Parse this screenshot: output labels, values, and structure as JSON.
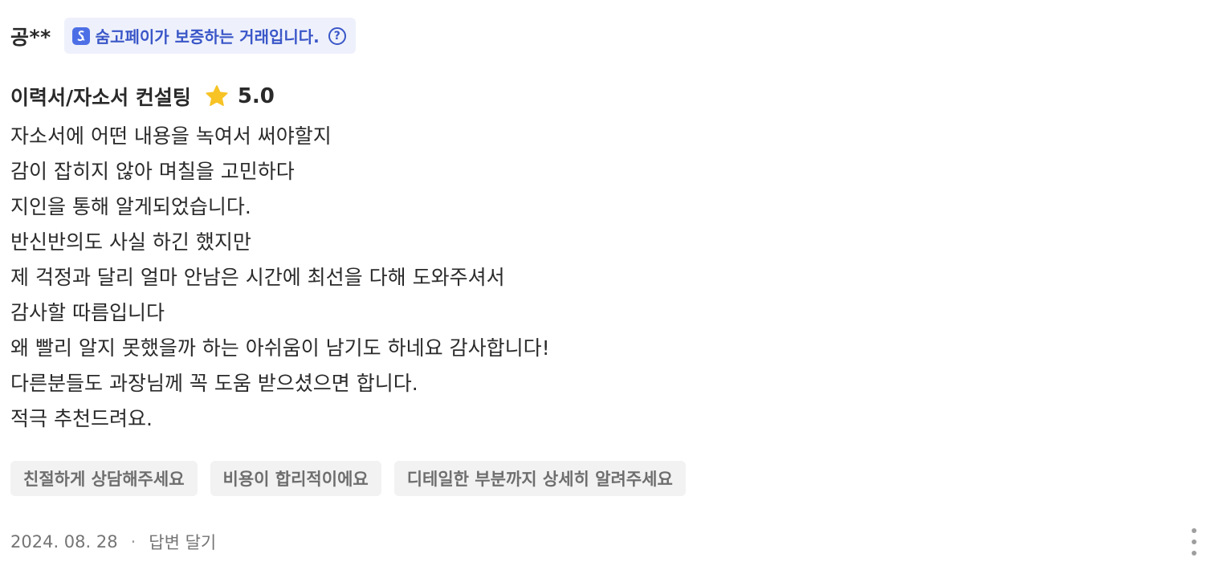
{
  "review": {
    "reviewer_name": "공**",
    "pay_badge": {
      "icon": "soomgo-pay-logo-icon",
      "text": "숨고페이가 보증하는 거래입니다.",
      "help_icon": "question-circle-icon",
      "help_glyph": "?"
    },
    "service_name": "이력서/자소서 컨설팅",
    "rating_icon": "star-icon",
    "rating": "5.0",
    "body_lines": [
      "자소서에 어떤 내용을 녹여서 써야할지",
      "감이 잡히지 않아 며칠을 고민하다",
      "지인을 통해 알게되었습니다.",
      "반신반의도 사실 하긴 했지만",
      "제 걱정과 달리 얼마 안남은 시간에 최선을 다해 도와주셔서",
      "감사할 따름입니다",
      "왜 빨리 알지 못했을까 하는 아쉬움이 남기도 하네요 감사합니다!",
      "다른분들도 과장님께 꼭 도움 받으셨으면 합니다.",
      "적극 추천드려요."
    ],
    "tags": [
      "친절하게 상담해주세요",
      "비용이 합리적이에요",
      "디테일한 부분까지 상세히 알려주세요"
    ],
    "date": "2024. 08. 28",
    "separator": "·",
    "reply_label": "답변 달기",
    "more_icon": "more-vertical-icon"
  },
  "colors": {
    "badge_bg": "#eef1fb",
    "badge_text": "#3a56c8",
    "star": "#f7c325",
    "tag_bg": "#f2f2f2",
    "tag_text": "#6e6e6e",
    "meta_text": "#757575"
  }
}
